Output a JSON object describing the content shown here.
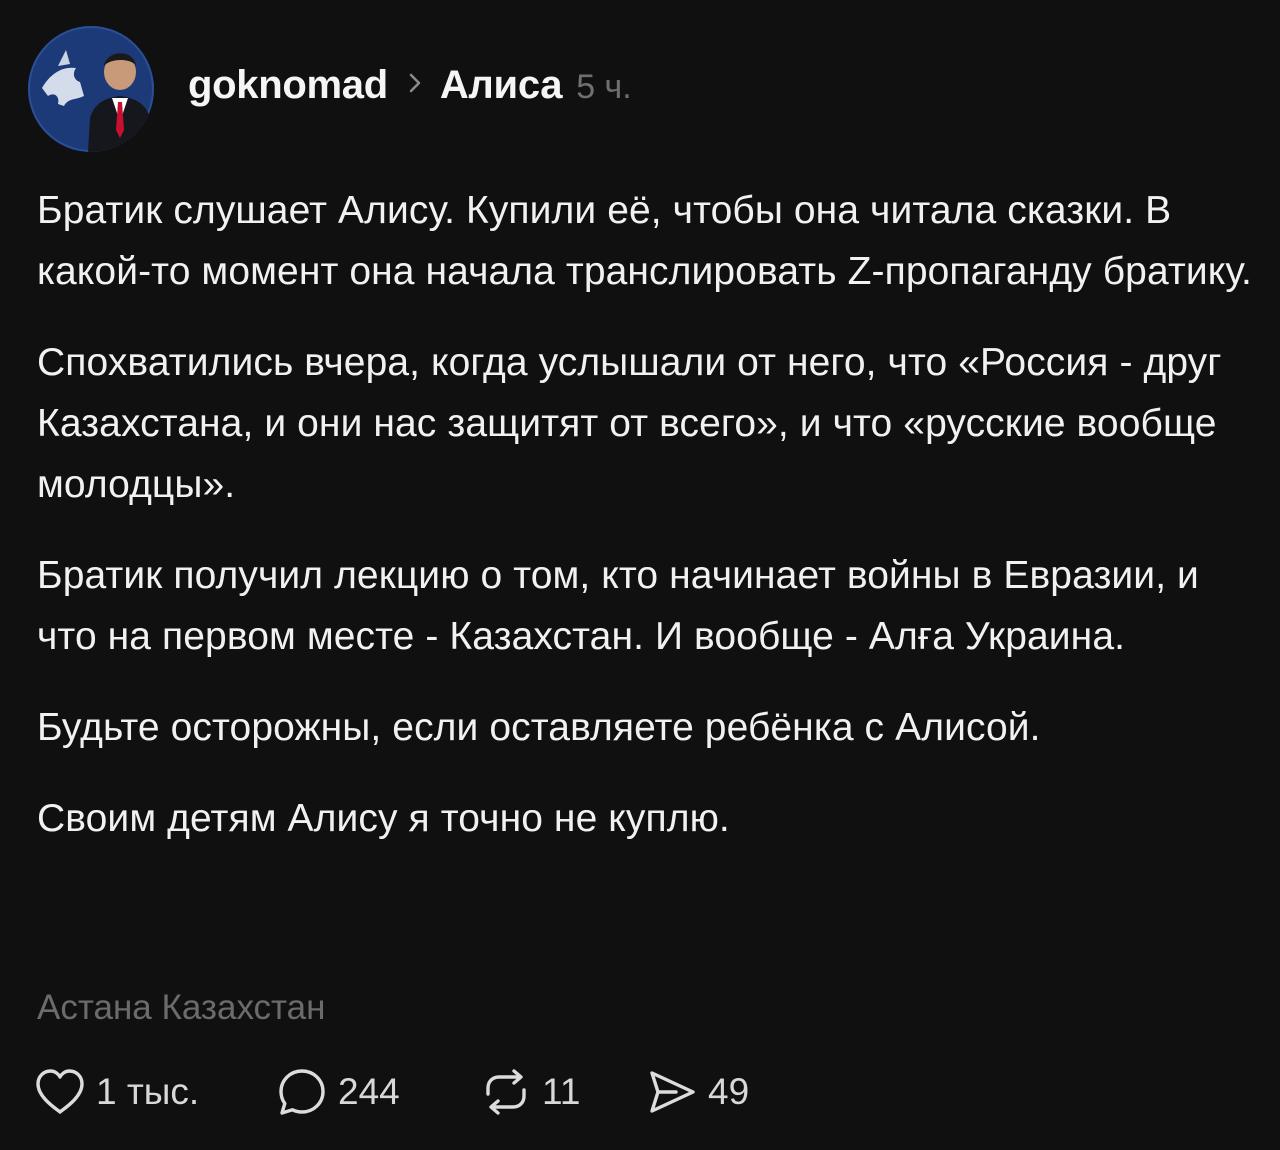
{
  "post": {
    "author": "goknomad",
    "topic": "Алиса",
    "time": "5 ч.",
    "paragraphs": [
      "Братик слушает Алису. Купили её, чтобы она читала сказки. В какой-то момент она начала транслировать Z-пропаганду братику.",
      "Спохватились вчера, когда услышали от него, что «Россия - друг Казахстана, и они нас защитят от всего», и что «русские вообще молодцы».",
      "Братик получил лекцию о том, кто начинает войны в Евразии, и что на первом месте - Казахстан. И вообще - Алға Украина.",
      "Будьте осторожны, если оставляете ребёнка с Алисой.",
      "Своим детям Алису я точно не куплю."
    ],
    "location": "Астана Казахстан"
  },
  "actions": {
    "likes": "1 тыс.",
    "comments": "244",
    "reposts": "11",
    "shares": "49"
  },
  "icons": {
    "like": "heart-icon",
    "comment": "speech-bubble-icon",
    "repost": "repost-icon",
    "share": "send-icon",
    "breadcrumb": "chevron-right-icon"
  },
  "colors": {
    "background": "#101010",
    "text": "#f1f1f1",
    "muted": "#6f6f6f",
    "avatar_bg": "#1d3a78"
  }
}
